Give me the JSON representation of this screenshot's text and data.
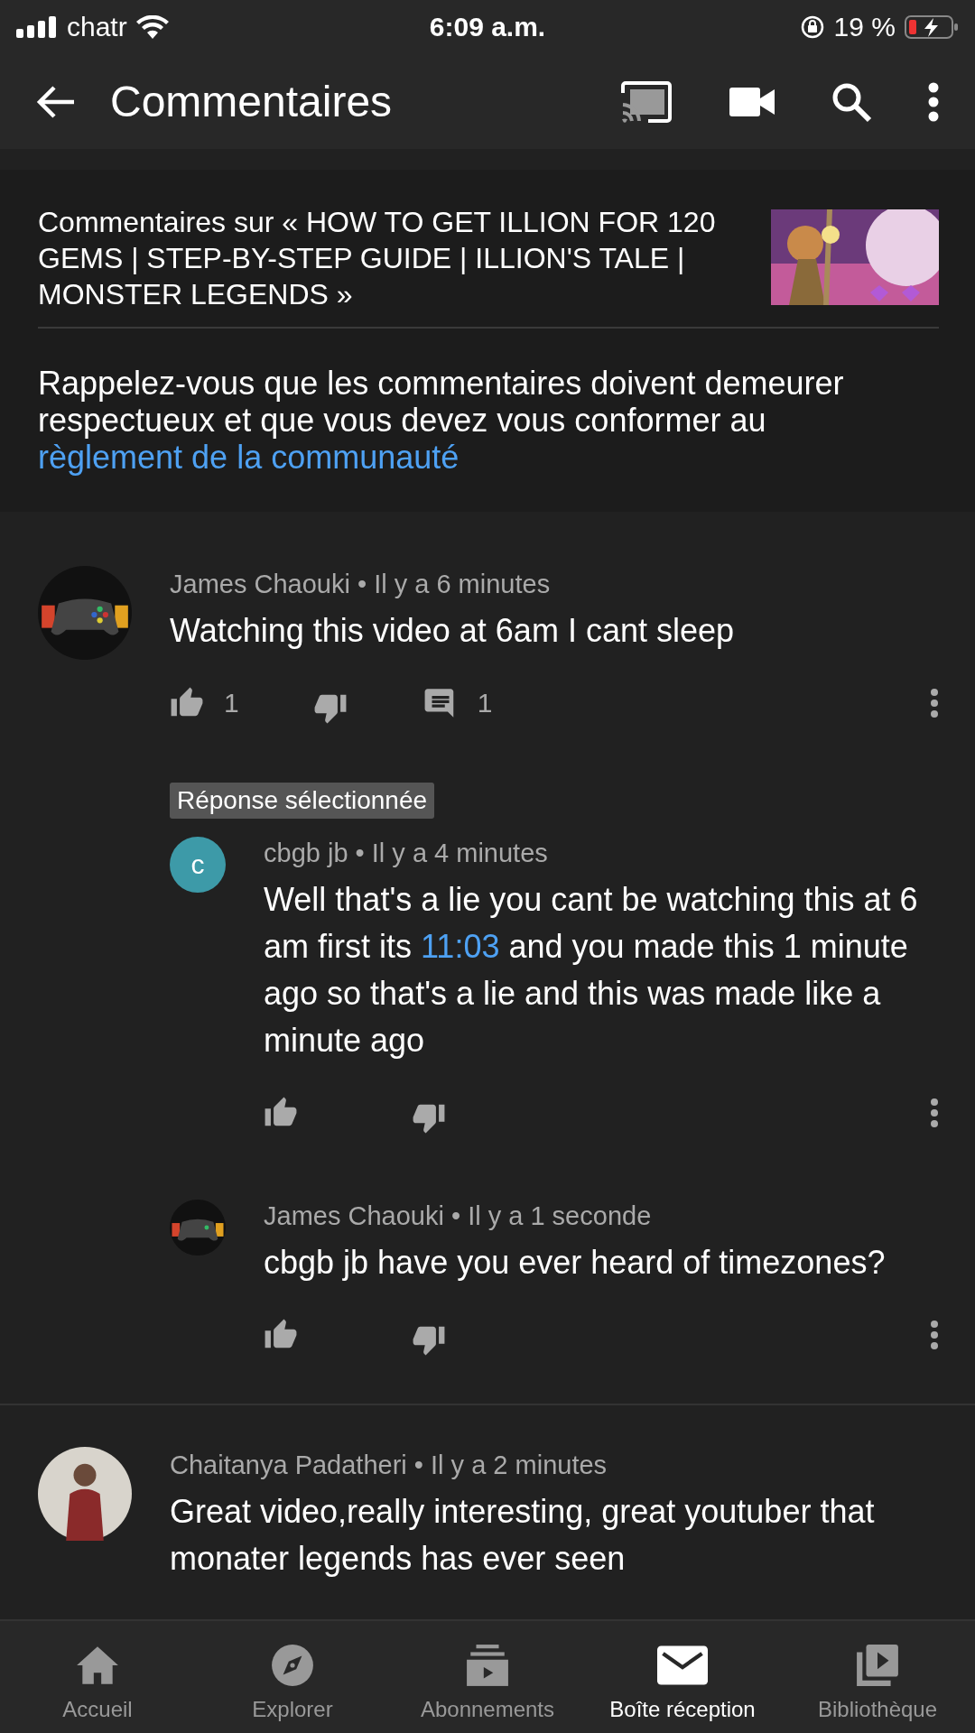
{
  "status_bar": {
    "carrier": "chatr",
    "time": "6:09 a.m.",
    "battery": "19 %"
  },
  "app_bar": {
    "title": "Commentaires"
  },
  "header": {
    "title": "Commentaires sur « HOW TO GET ILLION FOR 120 GEMS | STEP-BY-STEP GUIDE | ILLION'S TALE | MONSTER LEGENDS »",
    "notice": [
      {
        "text": "Rappelez-vous que les commentaires doivent demeurer respectueux et que vous devez vous conformer au ",
        "link": false
      },
      {
        "text": "règlement de la communauté",
        "link": true
      }
    ]
  },
  "comments": [
    {
      "meta": "James Chaouki • Il y a 6 minutes",
      "avatar": {
        "kind": "controller"
      },
      "body": [
        {
          "text": "Watching this video at 6am I cant sleep",
          "link": false
        }
      ],
      "likes": "1",
      "replies_count": "1",
      "selected_label": "Réponse sélectionnée",
      "replies": [
        {
          "meta": "cbgb jb • Il y a 4 minutes",
          "avatar": {
            "kind": "letter",
            "initial": "c",
            "color": "#3d9aa8"
          },
          "body": [
            {
              "text": "Well that's a lie you cant be watching this at 6 am first its ",
              "link": false
            },
            {
              "text": "11:03",
              "link": true
            },
            {
              "text": " and you made this 1 minute ago so that's a lie and this was made like a minute ago",
              "link": false
            }
          ]
        },
        {
          "meta": "James Chaouki • Il y a 1 seconde",
          "avatar": {
            "kind": "controller"
          },
          "body": [
            {
              "text": "cbgb jb have you ever heard of timezones?",
              "link": false
            }
          ]
        }
      ]
    },
    {
      "meta": "Chaitanya Padatheri • Il y a 2 minutes",
      "avatar": {
        "kind": "person"
      },
      "body": [
        {
          "text": "Great video,really interesting, great youtuber that monater legends has ever seen",
          "link": false
        }
      ]
    }
  ],
  "bottom_nav": [
    {
      "label": "Accueil",
      "kind": "home",
      "selected": false
    },
    {
      "label": "Explorer",
      "kind": "compass",
      "selected": false
    },
    {
      "label": "Abonnements",
      "kind": "subs",
      "selected": false
    },
    {
      "label": "Boîte réception",
      "kind": "mail",
      "selected": true
    },
    {
      "label": "Bibliothèque",
      "kind": "library",
      "selected": false
    }
  ]
}
